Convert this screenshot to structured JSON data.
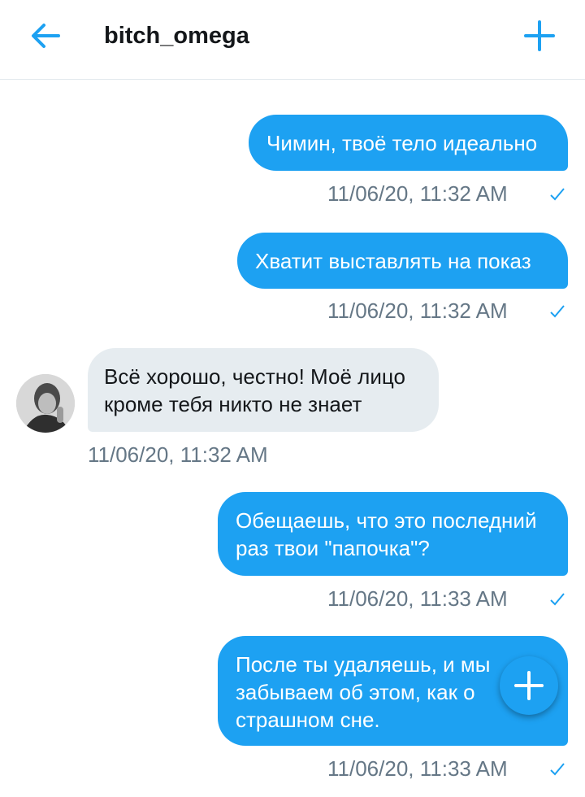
{
  "header": {
    "title": "bitch_omega",
    "back_icon": "arrow-left-icon",
    "add_icon": "plus-icon"
  },
  "colors": {
    "accent": "#1da1f2",
    "incoming_bubble": "#e6ecf0",
    "timestamp": "#657786"
  },
  "messages": [
    {
      "direction": "out",
      "lines": [
        "Чимин, твоё тело идеально"
      ],
      "time": "11/06/20, 11:32 AM",
      "status": "sent"
    },
    {
      "direction": "out",
      "lines": [
        "Хватит выставлять на показ"
      ],
      "time": "11/06/20, 11:32 AM",
      "status": "sent"
    },
    {
      "direction": "in",
      "lines": [
        "Всё хорошо, честно! Моё лицо",
        "кроме тебя никто не знает"
      ],
      "time": "11/06/20, 11:32 AM"
    },
    {
      "direction": "out",
      "lines": [
        "Обещаешь, что это последний",
        "раз твои \"папочка\"?"
      ],
      "time": "11/06/20, 11:33 AM",
      "status": "sent"
    },
    {
      "direction": "out",
      "lines": [
        "После ты удаляешь, и мы",
        "забываем об этом, как о",
        "страшном сне."
      ],
      "time": "11/06/20, 11:33 AM",
      "status": "sent"
    }
  ],
  "fab": {
    "icon": "plus-icon"
  }
}
